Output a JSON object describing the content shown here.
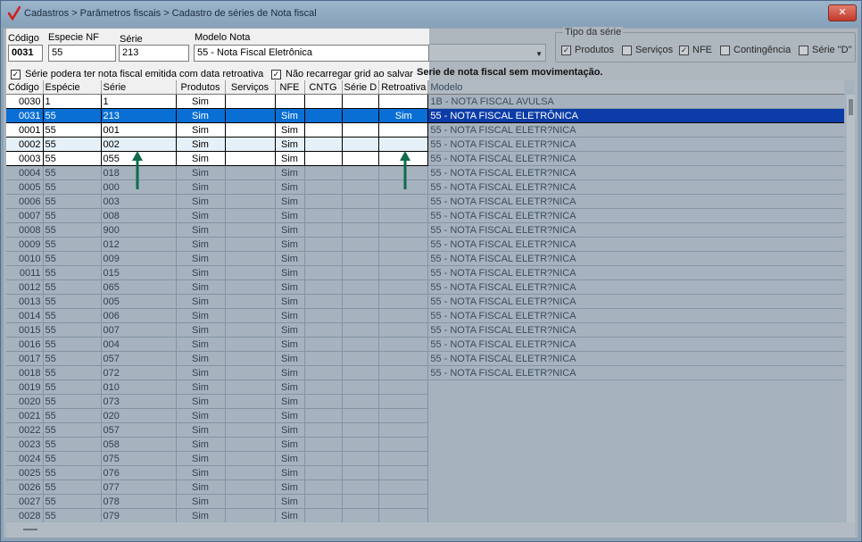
{
  "window": {
    "title": "Cadastros > Parâmetros fiscais > Cadastro de séries de Nota fiscal",
    "close_label": "✕"
  },
  "form": {
    "codigo_label": "Código",
    "codigo_value": "0031",
    "especie_label": "Especie NF",
    "especie_value": "55",
    "serie_label": "Série",
    "serie_value": "213",
    "modelo_label": "Modelo Nota",
    "modelo_value": "55 - Nota Fiscal Eletrônica"
  },
  "options": {
    "retroativa_label": "Série podera ter nota fiscal emitida com data retroativa",
    "retroativa_checked": true,
    "nao_recarregar_label": "Não recarregar grid ao salvar",
    "nao_recarregar_checked": true,
    "note": "Serie de nota fiscal sem movimentação."
  },
  "tipo_serie": {
    "legend": "Tipo da série",
    "items": [
      {
        "label": "Produtos",
        "checked": true
      },
      {
        "label": "Serviços",
        "checked": false
      },
      {
        "label": "NFE",
        "checked": true
      },
      {
        "label": "Contingência",
        "checked": false
      },
      {
        "label": "Série \"D\"",
        "checked": false
      }
    ]
  },
  "grid": {
    "columns": [
      "Código",
      "Espécie",
      "Série",
      "Produtos",
      "Serviços",
      "NFE",
      "CNTG",
      "Série D",
      "Retroativa",
      "Modelo"
    ],
    "rows": [
      {
        "codigo": "0030",
        "especie": "1",
        "serie": "1",
        "produtos": "Sim",
        "nfe": "",
        "retro": "",
        "modelo": "1B - NOTA FISCAL AVULSA",
        "style": "white"
      },
      {
        "codigo": "0031",
        "especie": "55",
        "serie": "213",
        "produtos": "Sim",
        "nfe": "Sim",
        "retro": "Sim",
        "modelo": "55 - NOTA FISCAL ELETRÔNICA",
        "style": "sel"
      },
      {
        "codigo": "0001",
        "especie": "55",
        "serie": "001",
        "produtos": "Sim",
        "nfe": "Sim",
        "retro": "",
        "modelo": "55 - NOTA FISCAL ELETR?NICA",
        "style": "white"
      },
      {
        "codigo": "0002",
        "especie": "55",
        "serie": "002",
        "produtos": "Sim",
        "nfe": "Sim",
        "retro": "",
        "modelo": "55 - NOTA FISCAL ELETR?NICA",
        "style": "alt"
      },
      {
        "codigo": "0003",
        "especie": "55",
        "serie": "055",
        "produtos": "Sim",
        "nfe": "Sim",
        "retro": "",
        "modelo": "55 - NOTA FISCAL ELETR?NICA",
        "style": "white"
      },
      {
        "codigo": "0004",
        "especie": "55",
        "serie": "018",
        "produtos": "Sim",
        "nfe": "Sim",
        "retro": "",
        "modelo": "55 - NOTA FISCAL ELETR?NICA",
        "style": "dim"
      },
      {
        "codigo": "0005",
        "especie": "55",
        "serie": "000",
        "produtos": "Sim",
        "nfe": "Sim",
        "retro": "",
        "modelo": "55 - NOTA FISCAL ELETR?NICA",
        "style": "dim"
      },
      {
        "codigo": "0006",
        "especie": "55",
        "serie": "003",
        "produtos": "Sim",
        "nfe": "Sim",
        "retro": "",
        "modelo": "55 - NOTA FISCAL ELETR?NICA",
        "style": "dim"
      },
      {
        "codigo": "0007",
        "especie": "55",
        "serie": "008",
        "produtos": "Sim",
        "nfe": "Sim",
        "retro": "",
        "modelo": "55 - NOTA FISCAL ELETR?NICA",
        "style": "dim"
      },
      {
        "codigo": "0008",
        "especie": "55",
        "serie": "900",
        "produtos": "Sim",
        "nfe": "Sim",
        "retro": "",
        "modelo": "55 - NOTA FISCAL ELETR?NICA",
        "style": "dim"
      },
      {
        "codigo": "0009",
        "especie": "55",
        "serie": "012",
        "produtos": "Sim",
        "nfe": "Sim",
        "retro": "",
        "modelo": "55 - NOTA FISCAL ELETR?NICA",
        "style": "dim"
      },
      {
        "codigo": "0010",
        "especie": "55",
        "serie": "009",
        "produtos": "Sim",
        "nfe": "Sim",
        "retro": "",
        "modelo": "55 - NOTA FISCAL ELETR?NICA",
        "style": "dim"
      },
      {
        "codigo": "0011",
        "especie": "55",
        "serie": "015",
        "produtos": "Sim",
        "nfe": "Sim",
        "retro": "",
        "modelo": "55 - NOTA FISCAL ELETR?NICA",
        "style": "dim"
      },
      {
        "codigo": "0012",
        "especie": "55",
        "serie": "065",
        "produtos": "Sim",
        "nfe": "Sim",
        "retro": "",
        "modelo": "55 - NOTA FISCAL ELETR?NICA",
        "style": "dim"
      },
      {
        "codigo": "0013",
        "especie": "55",
        "serie": "005",
        "produtos": "Sim",
        "nfe": "Sim",
        "retro": "",
        "modelo": "55 - NOTA FISCAL ELETR?NICA",
        "style": "dim"
      },
      {
        "codigo": "0014",
        "especie": "55",
        "serie": "006",
        "produtos": "Sim",
        "nfe": "Sim",
        "retro": "",
        "modelo": "55 - NOTA FISCAL ELETR?NICA",
        "style": "dim"
      },
      {
        "codigo": "0015",
        "especie": "55",
        "serie": "007",
        "produtos": "Sim",
        "nfe": "Sim",
        "retro": "",
        "modelo": "55 - NOTA FISCAL ELETR?NICA",
        "style": "dim"
      },
      {
        "codigo": "0016",
        "especie": "55",
        "serie": "004",
        "produtos": "Sim",
        "nfe": "Sim",
        "retro": "",
        "modelo": "55 - NOTA FISCAL ELETR?NICA",
        "style": "dim"
      },
      {
        "codigo": "0017",
        "especie": "55",
        "serie": "057",
        "produtos": "Sim",
        "nfe": "Sim",
        "retro": "",
        "modelo": "55 - NOTA FISCAL ELETR?NICA",
        "style": "dim"
      },
      {
        "codigo": "0018",
        "especie": "55",
        "serie": "072",
        "produtos": "Sim",
        "nfe": "Sim",
        "retro": "",
        "modelo": "55 - NOTA FISCAL ELETR?NICA",
        "style": "dim"
      },
      {
        "codigo": "0019",
        "especie": "55",
        "serie": "010",
        "produtos": "Sim",
        "nfe": "Sim",
        "retro": "",
        "modelo": "",
        "style": "dim"
      },
      {
        "codigo": "0020",
        "especie": "55",
        "serie": "073",
        "produtos": "Sim",
        "nfe": "Sim",
        "retro": "",
        "modelo": "",
        "style": "dim"
      },
      {
        "codigo": "0021",
        "especie": "55",
        "serie": "020",
        "produtos": "Sim",
        "nfe": "Sim",
        "retro": "",
        "modelo": "",
        "style": "dim"
      },
      {
        "codigo": "0022",
        "especie": "55",
        "serie": "057",
        "produtos": "Sim",
        "nfe": "Sim",
        "retro": "",
        "modelo": "",
        "style": "dim"
      },
      {
        "codigo": "0023",
        "especie": "55",
        "serie": "058",
        "produtos": "Sim",
        "nfe": "Sim",
        "retro": "",
        "modelo": "",
        "style": "dim"
      },
      {
        "codigo": "0024",
        "especie": "55",
        "serie": "075",
        "produtos": "Sim",
        "nfe": "Sim",
        "retro": "",
        "modelo": "",
        "style": "dim"
      },
      {
        "codigo": "0025",
        "especie": "55",
        "serie": "076",
        "produtos": "Sim",
        "nfe": "Sim",
        "retro": "",
        "modelo": "",
        "style": "dim"
      },
      {
        "codigo": "0026",
        "especie": "55",
        "serie": "077",
        "produtos": "Sim",
        "nfe": "Sim",
        "retro": "",
        "modelo": "",
        "style": "dim"
      },
      {
        "codigo": "0027",
        "especie": "55",
        "serie": "078",
        "produtos": "Sim",
        "nfe": "Sim",
        "retro": "",
        "modelo": "",
        "style": "dim"
      },
      {
        "codigo": "0028",
        "especie": "55",
        "serie": "079",
        "produtos": "Sim",
        "nfe": "Sim",
        "retro": "",
        "modelo": "",
        "style": "dim"
      }
    ]
  },
  "colors": {
    "selected_row": "#0a6fd4",
    "selected_model": "#0c3ca8",
    "annotation_arrow": "#0f6b4c"
  }
}
